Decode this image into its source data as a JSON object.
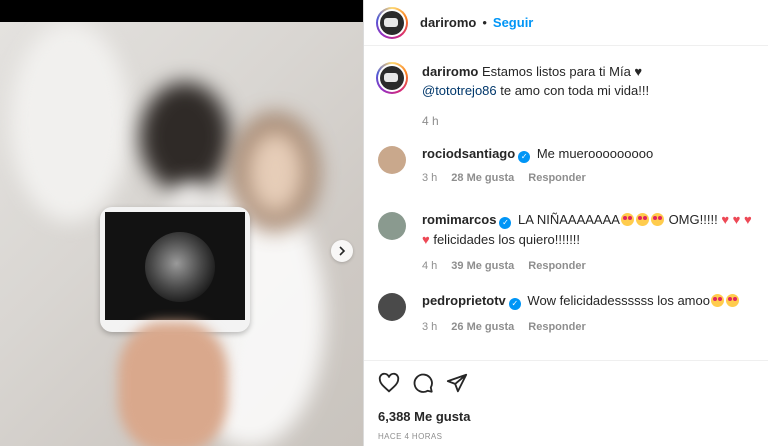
{
  "post": {
    "author": "dariromo",
    "follow_label": "Seguir",
    "separator": "•",
    "caption_text": "Estamos listos para ti Mía ♥",
    "caption_mention": "@tototrejo86",
    "caption_rest": " te amo con toda mi vida!!!",
    "caption_time": "4 h",
    "likes": "6,388 Me gusta",
    "date": "HACE 4 HORAS"
  },
  "comments": [
    {
      "user": "rociodsantiago",
      "verified": true,
      "text": "Me muerooooooooo",
      "time": "3 h",
      "likes": "28 Me gusta",
      "reply": "Responder",
      "avatar_color": "#c9a88c"
    },
    {
      "user": "romimarcos",
      "verified": true,
      "text_a": "LA NIÑAAAAAAA",
      "text_b": "OMG!!!!!",
      "text_c": "felicidades los quiero!!!!!!!",
      "time": "4 h",
      "likes": "39 Me gusta",
      "reply": "Responder",
      "avatar_color": "#8a9a8f"
    },
    {
      "user": "pedroprietotv",
      "verified": true,
      "text": "Wow felicidadessssss los amoo",
      "time": "3 h",
      "likes": "26 Me gusta",
      "reply": "Responder",
      "avatar_color": "#4a4a4a"
    }
  ],
  "icons": [
    "heart-icon",
    "comment-icon",
    "share-icon",
    "chevron-right-icon",
    "verified-icon"
  ],
  "colors": {
    "link": "#0095f6",
    "mention": "#00376b",
    "muted": "#8e8e8e",
    "heart": "#ed4956"
  }
}
